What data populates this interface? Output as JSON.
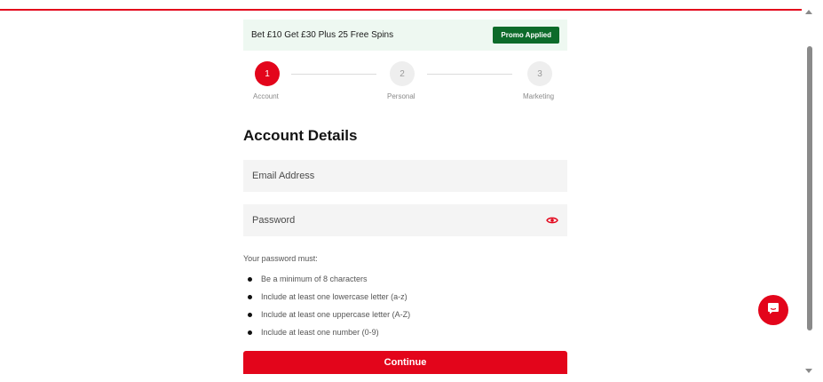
{
  "promo": {
    "text": "Bet £10 Get £30 Plus 25 Free Spins",
    "badge": "Promo Applied"
  },
  "steps": [
    {
      "number": "1",
      "label": "Account",
      "state": "active"
    },
    {
      "number": "2",
      "label": "Personal",
      "state": "inactive"
    },
    {
      "number": "3",
      "label": "Marketing",
      "state": "inactive"
    }
  ],
  "form": {
    "title": "Account Details",
    "email_placeholder": "Email Address",
    "password_placeholder": "Password",
    "rules_heading": "Your password must:",
    "rules": [
      "Be a minimum of 8 characters",
      "Include at least one lowercase letter (a-z)",
      "Include at least one uppercase letter (A-Z)",
      "Include at least one number (0-9)"
    ],
    "continue_label": "Continue"
  },
  "icons": {
    "password_toggle": "eye-icon",
    "chat": "chat-icon"
  },
  "colors": {
    "brand": "#e3051b",
    "promo_bg": "#eef8f1",
    "promo_badge": "#0d6b2a",
    "field_bg": "#f4f4f4"
  }
}
